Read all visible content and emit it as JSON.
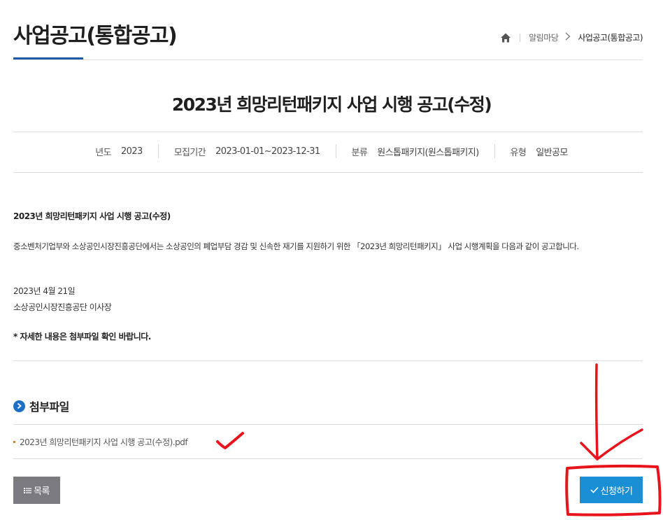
{
  "header": {
    "page_title": "사업공고(통합공고)",
    "breadcrumb": [
      "알림마당",
      "사업공고(통합공고)"
    ]
  },
  "post": {
    "title": "2023년 희망리턴패키지 사업 시행 공고(수정)",
    "meta": [
      {
        "label": "년도",
        "value": "2023"
      },
      {
        "label": "모집기간",
        "value": "2023-01-01~2023-12-31"
      },
      {
        "label": "분류",
        "value": "원스톱패키지(원스톱패키지)"
      },
      {
        "label": "유형",
        "value": "일반공모"
      }
    ],
    "body": {
      "heading": "2023년 희망리턴패키지 사업 시행 공고(수정)",
      "paragraph": "중소벤처기업부와 소상공인시장진흥공단에서는 소상공인의 폐업부담 경감 및 신속한 재기를 지원하기 위한 「2023년 희망리턴패키지」 사업 시행계획을 다음과 같이 공고합니다.",
      "date": "2023년 4월 21일",
      "issuer": "소상공인시장진흥공단 이사장",
      "note": "* 자세한 내용은 첨부파일 확인 바랍니다."
    }
  },
  "attachments": {
    "title": "첨부파일",
    "files": [
      "2023년 희망리턴패키지 사업 시행 공고(수정).pdf"
    ]
  },
  "buttons": {
    "list": "목록",
    "apply": "신청하기"
  },
  "colors": {
    "accent": "#1c5aa6",
    "apply_button": "#1a8fd6",
    "list_button": "#7a7a80",
    "annotation": "#e8141c"
  }
}
